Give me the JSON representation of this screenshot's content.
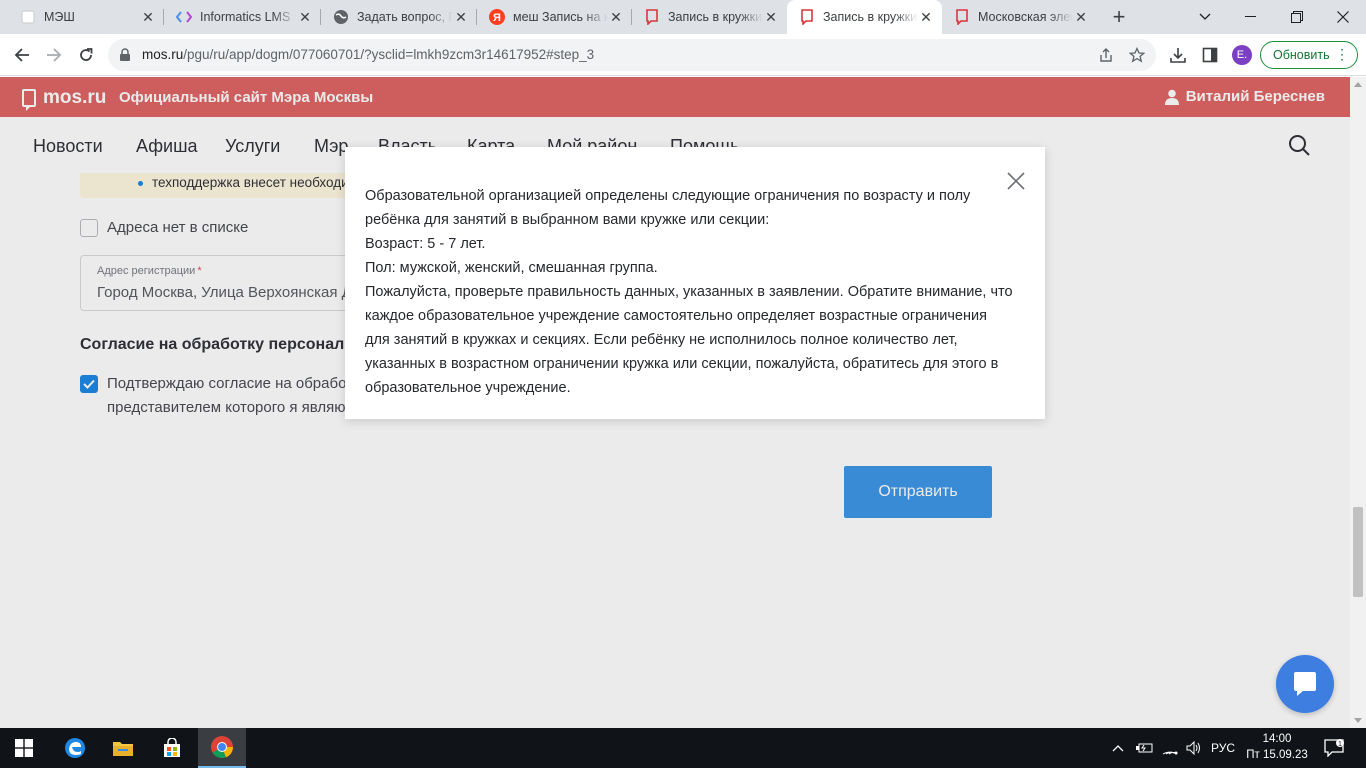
{
  "browser": {
    "tabs": [
      {
        "title": "МЭШ",
        "active": false
      },
      {
        "title": "Informatics LMS",
        "active": false
      },
      {
        "title": "Задать вопрос, Г",
        "active": false
      },
      {
        "title": "меш Запись на к",
        "active": false
      },
      {
        "title": "Запись в кружки",
        "active": false
      },
      {
        "title": "Запись в кружки",
        "active": true
      },
      {
        "title": "Московская элек",
        "active": false
      }
    ],
    "url_host": "mos.ru",
    "url_path": "/pgu/ru/app/dogm/077060701/?ysclid=lmkh9zcm3r14617952#step_3",
    "profile_initial": "E.",
    "update_label": "Обновить",
    "accent_color": "#1e8e3e"
  },
  "site": {
    "logo": "mos.ru",
    "title": "Официальный сайт Мэра Москвы",
    "user_name": "Виталий Береснев",
    "brand_color": "#e06666",
    "nav": [
      "Новости",
      "Афиша",
      "Услуги",
      "Мэр",
      "Власть",
      "Карта",
      "Мой район",
      "Помощь"
    ]
  },
  "form": {
    "note_text": "техподдержка внесет необходи",
    "no_address_label": "Адреса нет в списке",
    "address_label": "Адрес регистрации",
    "address_required_mark": "*",
    "address_value": "Город Москва, Улица Верхоянская Д",
    "consent_title": "Согласие на обработку персональ",
    "consent_line1": "Подтверждаю согласие на обрабо",
    "consent_line2": "представителем которого я являю",
    "consent_checked": true,
    "submit_label": "Отправить",
    "primary_color": "#3f97e8"
  },
  "modal": {
    "lines": [
      "Образовательной организацией определены следующие ограничения по возрасту и полу ребёнка для занятий в выбранном вами кружке или секции:",
      "Возраст: 5 - 7 лет.",
      "Пол: мужской, женский, смешанная группа.",
      "Пожалуйста, проверьте правильность данных, указанных в заявлении. Обратите внимание, что каждое образовательное учреждение самостоятельно определяет возрастные ограничения для занятий в кружках и секциях. Если ребёнку не исполнилось полное количество лет, указанных в возрастном ограничении кружка или секции, пожалуйста, обратитесь для этого в образовательное учреждение."
    ]
  },
  "taskbar": {
    "language": "РУС",
    "time": "14:00",
    "date": "Пт 15.09.23",
    "notification_count": "1"
  }
}
